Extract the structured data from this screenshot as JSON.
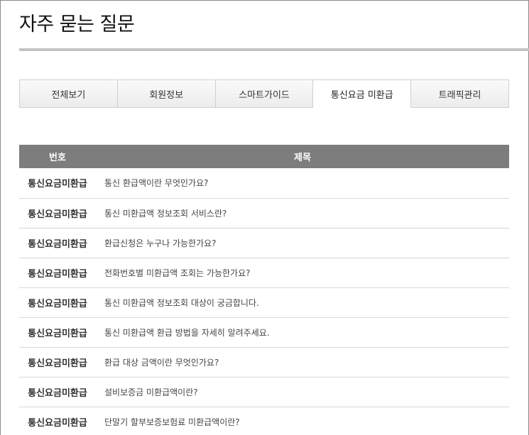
{
  "page": {
    "title": "자주 묻는 질문"
  },
  "tabs": [
    {
      "label": "전체보기"
    },
    {
      "label": "회원정보"
    },
    {
      "label": "스마트가이드"
    },
    {
      "label": "통신요금 미환급"
    },
    {
      "label": "트래픽관리"
    }
  ],
  "active_tab": "통신요금 미환급",
  "table": {
    "headers": {
      "number": "번호",
      "subject": "제목"
    },
    "rows": [
      {
        "category": "통신요금미환급",
        "question": "통신 환급액이란 무엇인가요?"
      },
      {
        "category": "통신요금미환급",
        "question": "통신 미환급액 정보조회 서비스란?"
      },
      {
        "category": "통신요금미환급",
        "question": "환급신청은 누구나 가능한가요?"
      },
      {
        "category": "통신요금미환급",
        "question": "전화번호별 미환급액 조회는 가능한가요?"
      },
      {
        "category": "통신요금미환급",
        "question": "통신 미환급액 정보조회 대상이 궁금합니다."
      },
      {
        "category": "통신요금미환급",
        "question": "통신 미환급액 환급 방법을 자세히 알려주세요."
      },
      {
        "category": "통신요금미환급",
        "question": "환급 대상 금액이란 무엇인가요?"
      },
      {
        "category": "통신요금미환급",
        "question": "설비보증금 미환급액이란?"
      },
      {
        "category": "통신요금미환급",
        "question": "단말기 할부보증보험료 미환급액이란?"
      }
    ]
  },
  "colors": {
    "header_bg": "#7d7d7d",
    "rule": "#c3c3c3",
    "tab_border": "#cfcfcf"
  }
}
